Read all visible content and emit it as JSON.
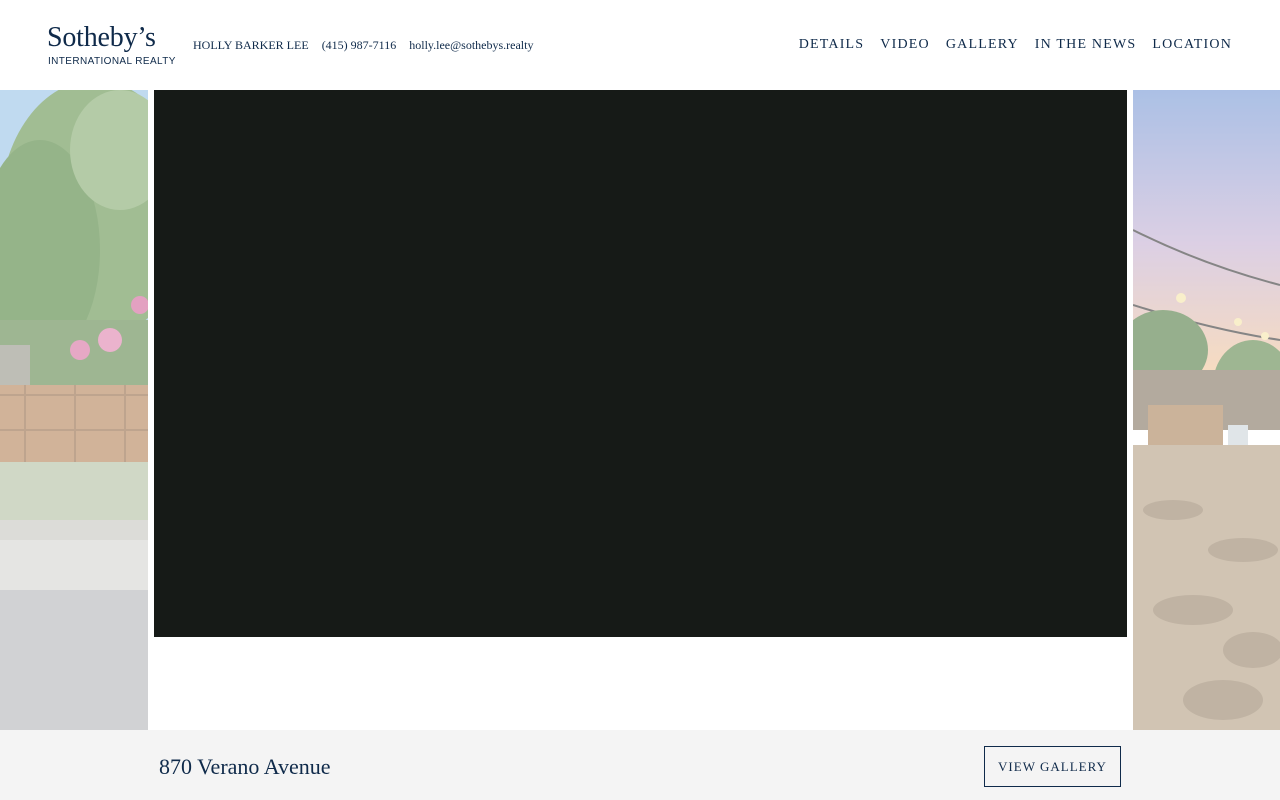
{
  "logo": {
    "main": "Sotheby’s",
    "sub": "INTERNATIONAL REALTY"
  },
  "agent": {
    "name": "HOLLY BARKER LEE",
    "phone": "(415) 987-7116",
    "email": "holly.lee@sothebys.realty"
  },
  "nav": [
    "DETAILS",
    "VIDEO",
    "GALLERY",
    "IN THE NEWS",
    "LOCATION"
  ],
  "property": {
    "address": "870 Verano Avenue"
  },
  "actions": {
    "view_gallery": "VIEW GALLERY"
  },
  "colors": {
    "brand_navy": "#0f2a4a",
    "footer_bg": "#f4f4f4",
    "video_bg": "#161a17"
  }
}
